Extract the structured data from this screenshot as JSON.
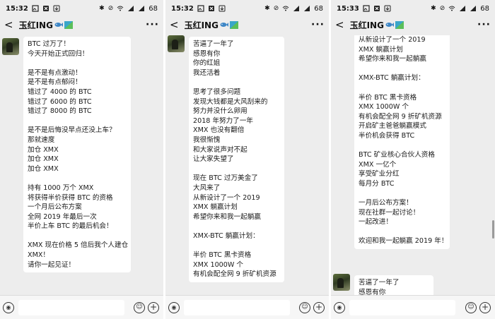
{
  "screens": [
    {
      "status": {
        "time": "15:32",
        "battery": "68"
      },
      "nav": {
        "back": "<",
        "title": "玉红ING",
        "more": "···"
      },
      "messages": [
        {
          "text": "BTC 过万了！\n今天开始正式回归！\n\n是不是有点激动！\n是不是有点郁闷！\n错过了 4000 的 BTC\n错过了 6000 的 BTC\n错过了 8000 的 BTC\n\n是不是后悔没早点还没上车？\n那就速度\n加仓 XMX\n加仓 XMX\n加仓 XMX\n\n持有 1000 万个 XMX\n将获得半价获得 BTC 的资格\n一个月后公布方案\n全网 2019 年最后一次\n半价上车 BTC 的最后机会！\n\nXMX 现在价格 5 倍后我个人建仓\nXMX！\n请你一起见证！"
        }
      ]
    },
    {
      "status": {
        "time": "15:32",
        "battery": "68"
      },
      "nav": {
        "back": "<",
        "title": "玉红ING",
        "more": "···"
      },
      "messages": [
        {
          "text": "苦逼了一年了\n感恩有你\n你的红姐\n我还活着\n\n思考了很多问题\n发现大钱都是大风刮来的\n努力并没什么卵用\n2018 年努力了一年\nXMX 也没有翻倍\n我很惭愧\n和大家说声对不起\n让大家失望了\n\n现在 BTC 过万美金了\n大风来了\n从新设计了一个 2019\nXMX 躺赢计划\n希望你来和我一起躺赢\n\nXMX-BTC 躺赢计划：\n\n半价 BTC 黑卡资格\nXMX 1000W 个\n有机会配全网 9 折矿机资源"
        }
      ]
    },
    {
      "status": {
        "time": "15:33",
        "battery": "68"
      },
      "nav": {
        "back": "<",
        "title": "玉红ING",
        "more": "···"
      },
      "messages": [
        {
          "text": "从新设计了一个 2019\nXMX 躺赢计划\n希望你来和我一起躺赢\n\nXMX-BTC 躺赢计划：\n\n半价 BTC 黑卡资格\nXMX 1000W 个\n有机会配全网 9 折矿机资源\n开启矿主爸爸躺赢模式\n半价机会获得 BTC\n\nBTC 矿业核心合伙人资格\nXMX 一亿个\n享受矿业分红\n每月分 BTC\n\n一月后公布方案！\n现在社群一起讨论！\n一起改进！\n\n欢迎和我一起躺赢 2019 年！"
        },
        {
          "text": "苦逼了一年了\n感恩有你"
        }
      ]
    }
  ]
}
